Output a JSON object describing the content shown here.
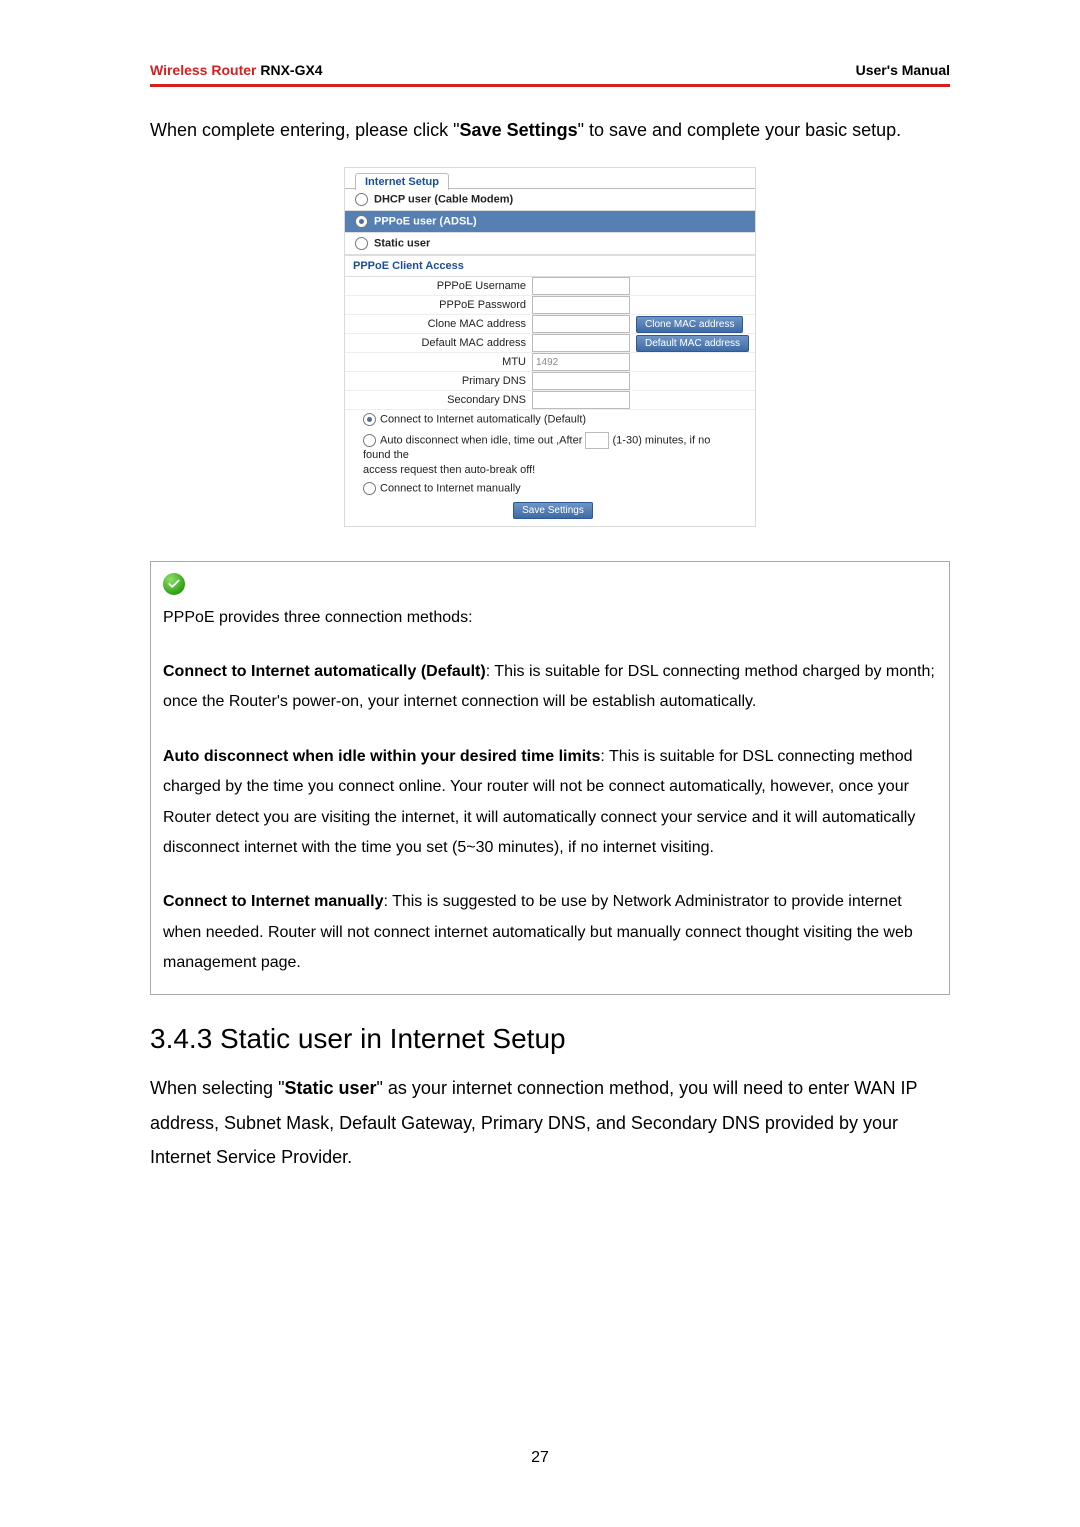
{
  "header": {
    "brand": "Wireless Router",
    "model": " RNX-GX4",
    "right": "User's Manual"
  },
  "intro": {
    "pre": "When complete entering, please click \"",
    "bold": "Save Settings",
    "post": "\" to save and complete your basic setup."
  },
  "shot": {
    "tab": "Internet Setup",
    "opt_dhcp": "DHCP user (Cable Modem)",
    "opt_pppoe": "PPPoE user (ADSL)",
    "opt_static": "Static user",
    "section": "PPPoE Client Access",
    "lbl_user": "PPPoE Username",
    "lbl_pass": "PPPoE Password",
    "lbl_clone": "Clone MAC address",
    "val_clone": "",
    "btn_clone": "Clone MAC address",
    "lbl_defmac": "Default MAC address",
    "val_defmac": "",
    "btn_defmac": "Default MAC address",
    "lbl_mtu": "MTU",
    "val_mtu": "1492",
    "lbl_pdns": "Primary DNS",
    "lbl_sdns": "Secondary DNS",
    "r1": "Connect to Internet automatically (Default)",
    "r2a": "Auto disconnect when idle, time out ,After",
    "r2b": "(1-30) minutes, if no found the",
    "r2c": "access request then auto-break off!",
    "r3": "Connect to Internet manually",
    "save": "Save Settings"
  },
  "note": {
    "lead": "PPPoE provides three connection methods:",
    "b1": "Connect to Internet automatically (Default)",
    "t1": ": This is suitable for DSL connecting method charged by month; once the Router's power-on, your internet connection will be establish automatically.",
    "b2": "Auto disconnect when idle within your desired time limits",
    "t2": ": This is suitable for DSL connecting method charged by the time you connect online. Your router will not be connect automatically, however, once your Router detect you are visiting the internet, it will automatically connect your service and it will automatically disconnect internet with the time you set (5~30 minutes), if no internet visiting.",
    "b3": "Connect to Internet manually",
    "t3": ": This is suggested to be use by Network Administrator to provide internet when needed. Router will not connect internet automatically but manually connect thought visiting the web management page."
  },
  "h2": "3.4.3 Static user in Internet Setup",
  "static_para": {
    "pre": "When selecting \"",
    "bold": "Static user",
    "post": "\" as your internet connection method, you will need to enter WAN IP address, Subnet Mask, Default Gateway, Primary DNS, and Secondary DNS provided by your Internet Service Provider."
  },
  "pagenum": "27"
}
